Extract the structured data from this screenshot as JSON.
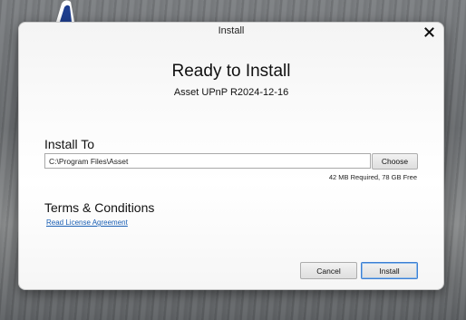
{
  "window": {
    "title": "Install"
  },
  "main": {
    "heading": "Ready to Install",
    "subheading": "Asset UPnP R2024-12-16"
  },
  "install_to": {
    "label": "Install To",
    "path_value": "C:\\Program Files\\Asset",
    "choose_label": "Choose",
    "space_info": "42 MB Required, 78 GB Free"
  },
  "terms": {
    "label": "Terms & Conditions",
    "link_text": "Read License Agreement"
  },
  "buttons": {
    "cancel_label": "Cancel",
    "install_label": "Install"
  },
  "colors": {
    "accent": "#1a5fb4",
    "default_button_border": "#3c7fd4"
  },
  "icons": {
    "close": "close-icon",
    "desktop_app": "app-logo-icon"
  }
}
